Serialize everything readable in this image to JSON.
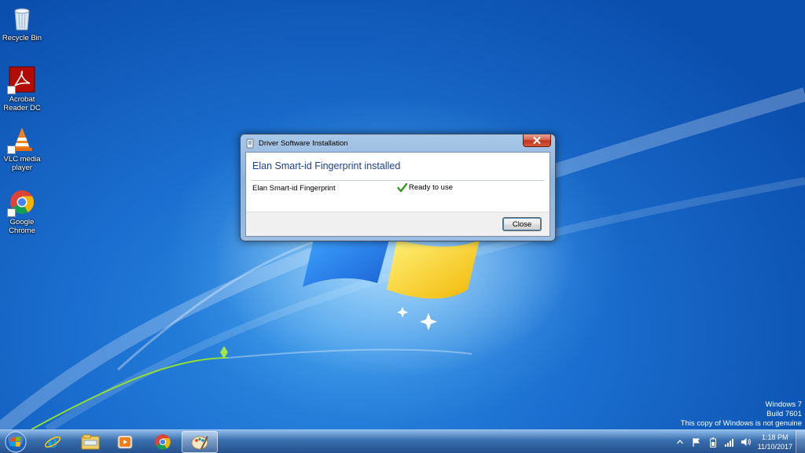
{
  "desktop": {
    "icons": [
      {
        "label": "Recycle Bin",
        "icon": "recycle-bin-icon"
      },
      {
        "label": "Acrobat Reader DC",
        "icon": "acrobat-icon"
      },
      {
        "label": "VLC media player",
        "icon": "vlc-icon"
      },
      {
        "label": "Google Chrome",
        "icon": "chrome-icon"
      }
    ],
    "watermark": {
      "line1": "Windows 7",
      "line2": "Build 7601",
      "line3": "This copy of Windows is not genuine"
    }
  },
  "dialog": {
    "title": "Driver Software Installation",
    "heading": "Elan Smart-id Fingerprint installed",
    "device": {
      "name": "Elan Smart-id Fingerprint",
      "status": "Ready to use"
    },
    "close_label": "Close"
  },
  "taskbar": {
    "items": [
      "start-orb",
      "internet-explorer-icon",
      "windows-explorer-icon",
      "media-player-icon",
      "chrome-icon",
      "paint-icon"
    ],
    "clock": {
      "time": "1:18 PM",
      "date": "11/10/2017"
    }
  },
  "colors": {
    "desktop_blue": "#1466c8",
    "dialog_heading": "#1e3f8f",
    "close_red": "#c0301c"
  }
}
